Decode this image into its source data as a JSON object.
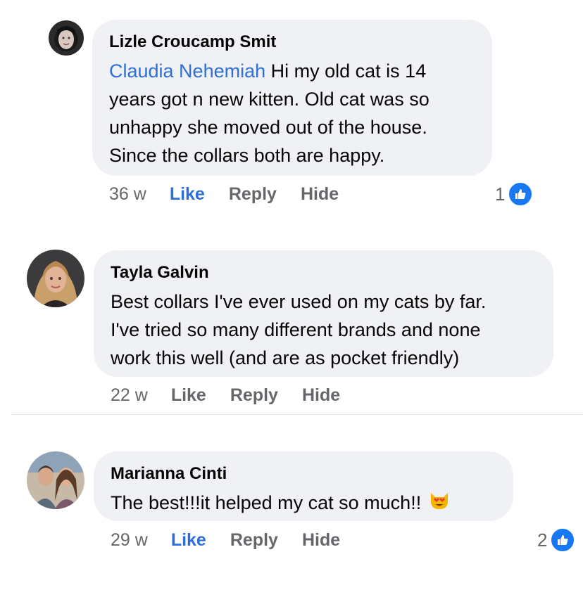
{
  "comments": [
    {
      "author": "Lizle Croucamp Smit",
      "mention": "Claudia Nehemiah",
      "lines": [
        " Hi my old cat is 14",
        "years got n new kitten. Old cat was so",
        "unhappy she moved out of the house.",
        "Since the collars both are happy."
      ],
      "time": "36 w",
      "like": "Like",
      "reply": "Reply",
      "hide": "Hide",
      "reaction_count": "1"
    },
    {
      "author": "Tayla Galvin",
      "lines": [
        "Best collars I've ever used on my cats by far.",
        "I've tried so many different brands and none",
        "work this well (and are as pocket friendly)"
      ],
      "time": "22 w",
      "like": "Like",
      "reply": "Reply",
      "hide": "Hide"
    },
    {
      "author": "Marianna Cinti",
      "lines": [
        "The best!!!it helped my cat so much!!"
      ],
      "emoji": "heart-eyes-cat",
      "time": "29 w",
      "like": "Like",
      "reply": "Reply",
      "hide": "Hide",
      "reaction_count": "2"
    }
  ],
  "colors": {
    "bubble": "#f0f1f4",
    "link_blue": "#2d6fd6",
    "meta_gray": "#65676b",
    "like_badge": "#1877f2"
  }
}
